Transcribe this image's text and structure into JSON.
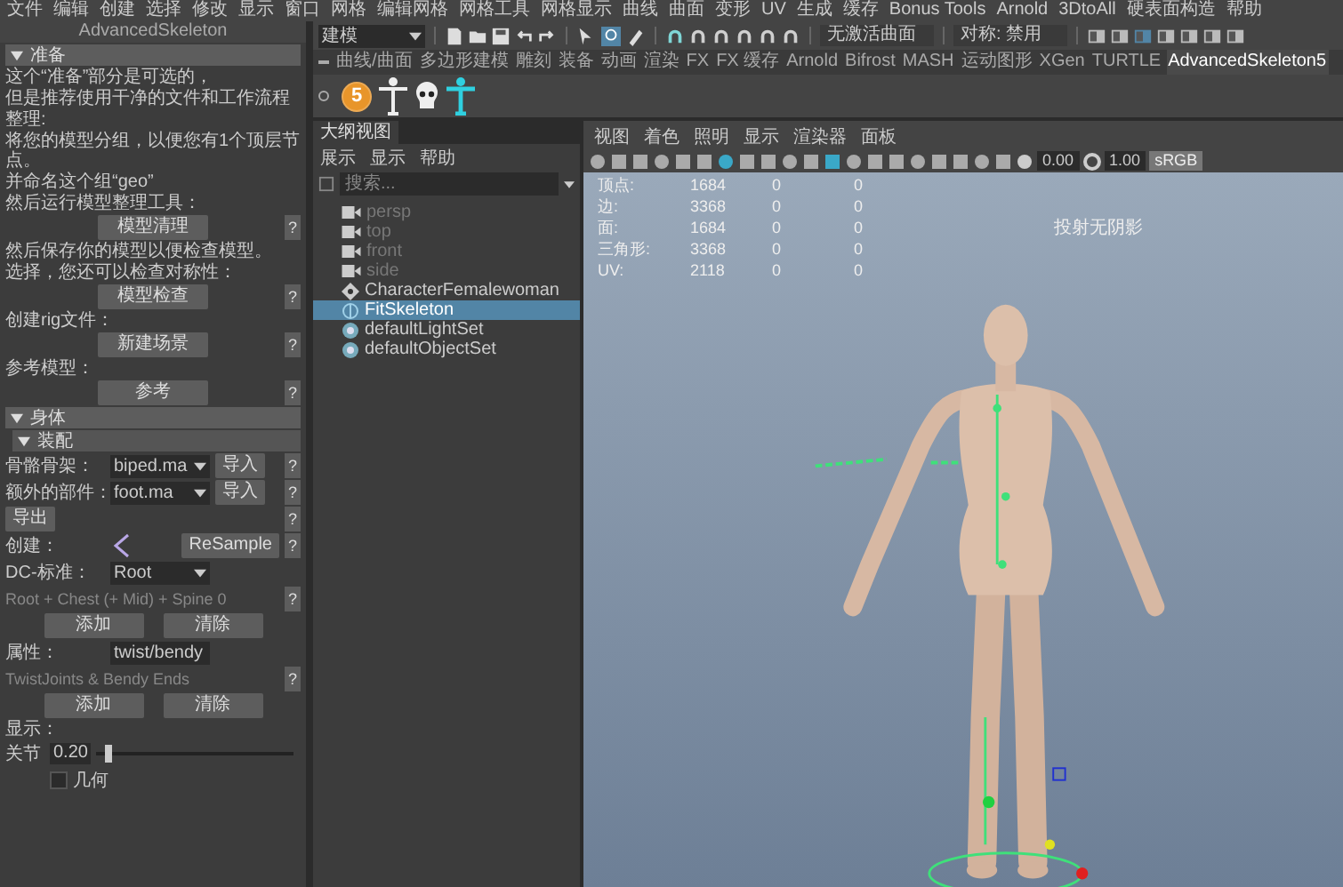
{
  "menu_bar": [
    "文件",
    "编辑",
    "创建",
    "选择",
    "修改",
    "显示",
    "窗口",
    "网格",
    "编辑网格",
    "网格工具",
    "网格显示",
    "曲线",
    "曲面",
    "变形",
    "UV",
    "生成",
    "缓存",
    "Bonus Tools",
    "Arnold",
    "3DtoAll",
    "硬表面构造",
    "帮助"
  ],
  "left_panel": {
    "title": "AdvancedSkeleton",
    "items": [
      {
        "kind": "header",
        "label": "准备",
        "expanded": true
      },
      {
        "kind": "text",
        "text": "这个“准备”部分是可选的，"
      },
      {
        "kind": "text",
        "text": "但是推荐使用干净的文件和工作流程"
      },
      {
        "kind": "text",
        "text": "整理:"
      },
      {
        "kind": "text",
        "text": "将您的模型分组，以便您有1个顶层节点。"
      },
      {
        "kind": "text",
        "text": "并命名这个组“geo”"
      },
      {
        "kind": "text",
        "text": "然后运行模型整理工具："
      },
      {
        "kind": "button",
        "label": "模型清理",
        "help": "?"
      },
      {
        "kind": "text",
        "text": "然后保存你的模型以便检查模型。"
      },
      {
        "kind": "text",
        "text": "选择，您还可以检查对称性："
      },
      {
        "kind": "button",
        "label": "模型检查",
        "help": "?"
      },
      {
        "kind": "text",
        "text": "创建rig文件："
      },
      {
        "kind": "button",
        "label": "新建场景",
        "help": "?"
      },
      {
        "kind": "text",
        "text": "参考模型："
      },
      {
        "kind": "button",
        "label": "参考",
        "help": "?"
      },
      {
        "kind": "header",
        "label": "身体",
        "expanded": true
      },
      {
        "kind": "subheader",
        "label": "装配",
        "expanded": true
      },
      {
        "kind": "select",
        "label": "骨骼骨架：",
        "value": "biped.ma",
        "button": "导入",
        "help": "?"
      },
      {
        "kind": "select",
        "label": "额外的部件：",
        "value": "foot.ma",
        "button": "导入",
        "help": "?"
      },
      {
        "kind": "button_right",
        "button": "导出",
        "help": "?"
      },
      {
        "kind": "resample",
        "label": "创建：",
        "button": "ReSample",
        "help": "?"
      },
      {
        "kind": "select",
        "label": "DC-标准：",
        "value": "Root"
      },
      {
        "kind": "note",
        "text": "Root + Chest (+ Mid) + Spine 0",
        "help": "?"
      },
      {
        "kind": "pair",
        "buttons": [
          "添加",
          "清除"
        ]
      },
      {
        "kind": "select",
        "label": "属性：",
        "value": "twist/bendy"
      },
      {
        "kind": "note",
        "text": "TwistJoints & Bendy Ends",
        "help": "?"
      },
      {
        "kind": "pair",
        "buttons": [
          "添加",
          "清除"
        ]
      },
      {
        "kind": "text",
        "text": "显示："
      },
      {
        "kind": "slider",
        "label": "关节",
        "value": "0.20",
        "level": 0.04
      },
      {
        "kind": "checkbox",
        "label": "几何",
        "checked": false
      }
    ]
  },
  "toolbar": {
    "mode": "建模",
    "surface": "无激活曲面",
    "symmetry": "对称: 禁用"
  },
  "shelf_tabs": [
    {
      "label": "曲线/曲面",
      "selected": false
    },
    {
      "label": "多边形建模",
      "selected": false
    },
    {
      "label": "雕刻",
      "selected": false
    },
    {
      "label": "装备",
      "selected": false
    },
    {
      "label": "动画",
      "selected": false
    },
    {
      "label": "渲染",
      "selected": false
    },
    {
      "label": "FX",
      "selected": false
    },
    {
      "label": "FX 缓存",
      "selected": false
    },
    {
      "label": "Arnold",
      "selected": false
    },
    {
      "label": "Bifrost",
      "selected": false
    },
    {
      "label": "MASH",
      "selected": false
    },
    {
      "label": "运动图形",
      "selected": false
    },
    {
      "label": "XGen",
      "selected": false
    },
    {
      "label": "TURTLE",
      "selected": false
    },
    {
      "label": "AdvancedSkeleton5",
      "selected": true
    }
  ],
  "shelf": {
    "badge": "5"
  },
  "outliner": {
    "title": "大纲视图",
    "menu": [
      "展示",
      "显示",
      "帮助"
    ],
    "placeholder": "搜索...",
    "items": [
      {
        "label": "persp",
        "kind": "camera",
        "dimmed": true,
        "selected": false
      },
      {
        "label": "top",
        "kind": "camera",
        "dimmed": true,
        "selected": false
      },
      {
        "label": "front",
        "kind": "camera",
        "dimmed": true,
        "selected": false
      },
      {
        "label": "side",
        "kind": "camera",
        "dimmed": true,
        "selected": false
      },
      {
        "label": "CharacterFemalewoman",
        "kind": "transform",
        "dimmed": false,
        "selected": false
      },
      {
        "label": "FitSkeleton",
        "kind": "joint",
        "dimmed": false,
        "selected": true
      },
      {
        "label": "defaultLightSet",
        "kind": "set",
        "dimmed": false,
        "selected": false
      },
      {
        "label": "defaultObjectSet",
        "kind": "set",
        "dimmed": false,
        "selected": false
      }
    ]
  },
  "viewport": {
    "menu": [
      "视图",
      "着色",
      "照明",
      "显示",
      "渲染器",
      "面板"
    ],
    "exposure": "0.00",
    "gamma": "1.00",
    "color_space": "sRGB",
    "hud_rows": [
      {
        "label": "顶点:",
        "values": [
          "1684",
          "0",
          "0"
        ]
      },
      {
        "label": "边:",
        "values": [
          "3368",
          "0",
          "0"
        ]
      },
      {
        "label": "面:",
        "values": [
          "1684",
          "0",
          "0"
        ]
      },
      {
        "label": "三角形:",
        "values": [
          "3368",
          "0",
          "0"
        ]
      },
      {
        "label": "UV:",
        "values": [
          "2118",
          "0",
          "0"
        ]
      }
    ],
    "hud_message": "投射无阴影"
  }
}
